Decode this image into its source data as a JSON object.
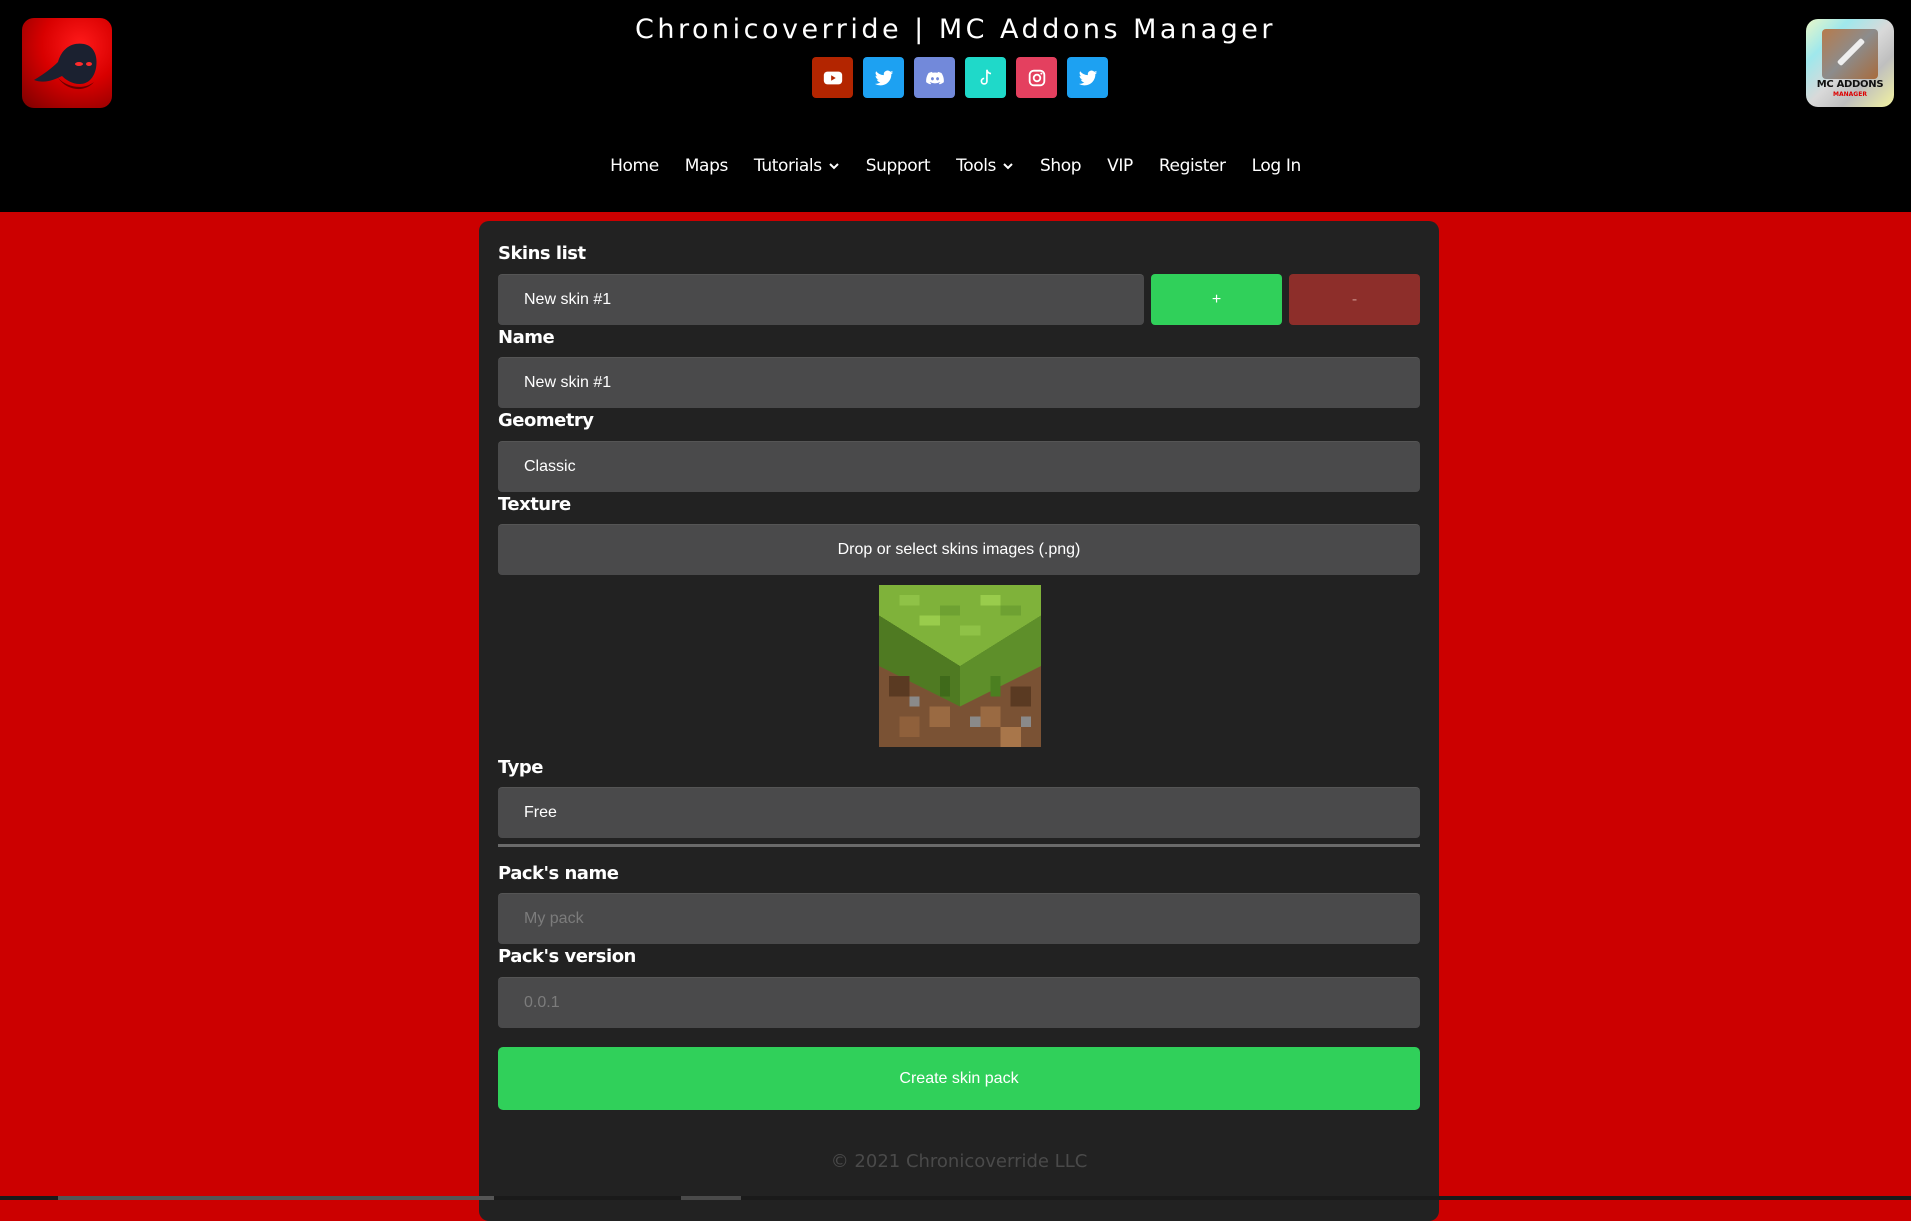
{
  "header": {
    "title": "Chronicoverride | MC Addons Manager",
    "logo_left": "Chronicoverride hooded ninja logo",
    "logo_right": {
      "line1": "MC ADDONS",
      "line2": "MANAGER"
    },
    "socials": [
      {
        "name": "youtube",
        "icon": "youtube-icon",
        "color": "#b32500"
      },
      {
        "name": "twitter",
        "icon": "twitter-icon",
        "color": "#1da1f2"
      },
      {
        "name": "discord",
        "icon": "discord-icon",
        "color": "#7289da"
      },
      {
        "name": "tiktok",
        "icon": "tiktok-icon",
        "color": "#1fd9c9"
      },
      {
        "name": "instagram",
        "icon": "instagram-icon",
        "color": "#e4405f"
      },
      {
        "name": "twitter",
        "icon": "twitter-icon",
        "color": "#1da1f2"
      }
    ]
  },
  "nav": {
    "items": [
      {
        "label": "Home",
        "dropdown": false
      },
      {
        "label": "Maps",
        "dropdown": false
      },
      {
        "label": "Tutorials",
        "dropdown": true
      },
      {
        "label": "Support",
        "dropdown": false
      },
      {
        "label": "Tools",
        "dropdown": true
      },
      {
        "label": "Shop",
        "dropdown": false
      },
      {
        "label": "VIP",
        "dropdown": false
      },
      {
        "label": "Register",
        "dropdown": false
      },
      {
        "label": "Log In",
        "dropdown": false
      }
    ]
  },
  "form": {
    "skins_list": {
      "label": "Skins list",
      "selected": "New skin #1",
      "add_label": "+",
      "remove_label": "-"
    },
    "name": {
      "label": "Name",
      "value": "New skin #1"
    },
    "geometry": {
      "label": "Geometry",
      "value": "Classic"
    },
    "texture": {
      "label": "Texture",
      "drop_label": "Drop or select skins images (.png)",
      "preview": "grass block"
    },
    "type": {
      "label": "Type",
      "value": "Free"
    },
    "pack_name": {
      "label": "Pack's name",
      "placeholder": "My pack"
    },
    "pack_version": {
      "label": "Pack's version",
      "placeholder": "0.0.1"
    },
    "create_label": "Create skin pack"
  },
  "footer": {
    "copyright": "© 2021 Chronicoverride LLC"
  },
  "colors": {
    "page_bg": "#cc0000",
    "header_bg": "#000000",
    "card_bg": "#222222",
    "input_bg": "#4a4a4b",
    "accent_green": "#30d05a",
    "remove_red": "#8d2e2a"
  }
}
